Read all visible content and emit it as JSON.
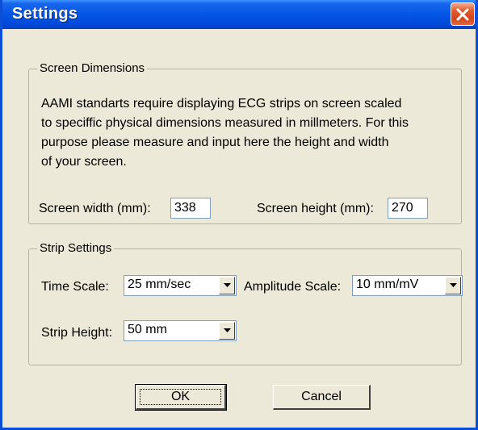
{
  "window": {
    "title": "Settings"
  },
  "icons": {
    "close": "close-icon",
    "dropdown": "chevron-down-icon"
  },
  "screen_dimensions": {
    "legend": "Screen Dimensions",
    "description_lines": [
      "AAMI standarts require displaying ECG strips on screen scaled",
      "to speciffic physical dimensions measured in millmeters. For this",
      "purpose please measure and input here the height and width",
      "of your screen."
    ],
    "width_label": "Screen width (mm):",
    "width_value": "338",
    "height_label": "Screen height (mm):",
    "height_value": "270"
  },
  "strip_settings": {
    "legend": "Strip Settings",
    "time_scale_label": "Time Scale:",
    "time_scale_value": "25 mm/sec",
    "amplitude_scale_label": "Amplitude Scale:",
    "amplitude_scale_value": "10 mm/mV",
    "strip_height_label": "Strip Height:",
    "strip_height_value": "50 mm"
  },
  "buttons": {
    "ok": "OK",
    "cancel": "Cancel"
  },
  "colors": {
    "titlebar": "#0558e6",
    "dialog_bg": "#ece9d8",
    "close_button": "#d2441c"
  }
}
